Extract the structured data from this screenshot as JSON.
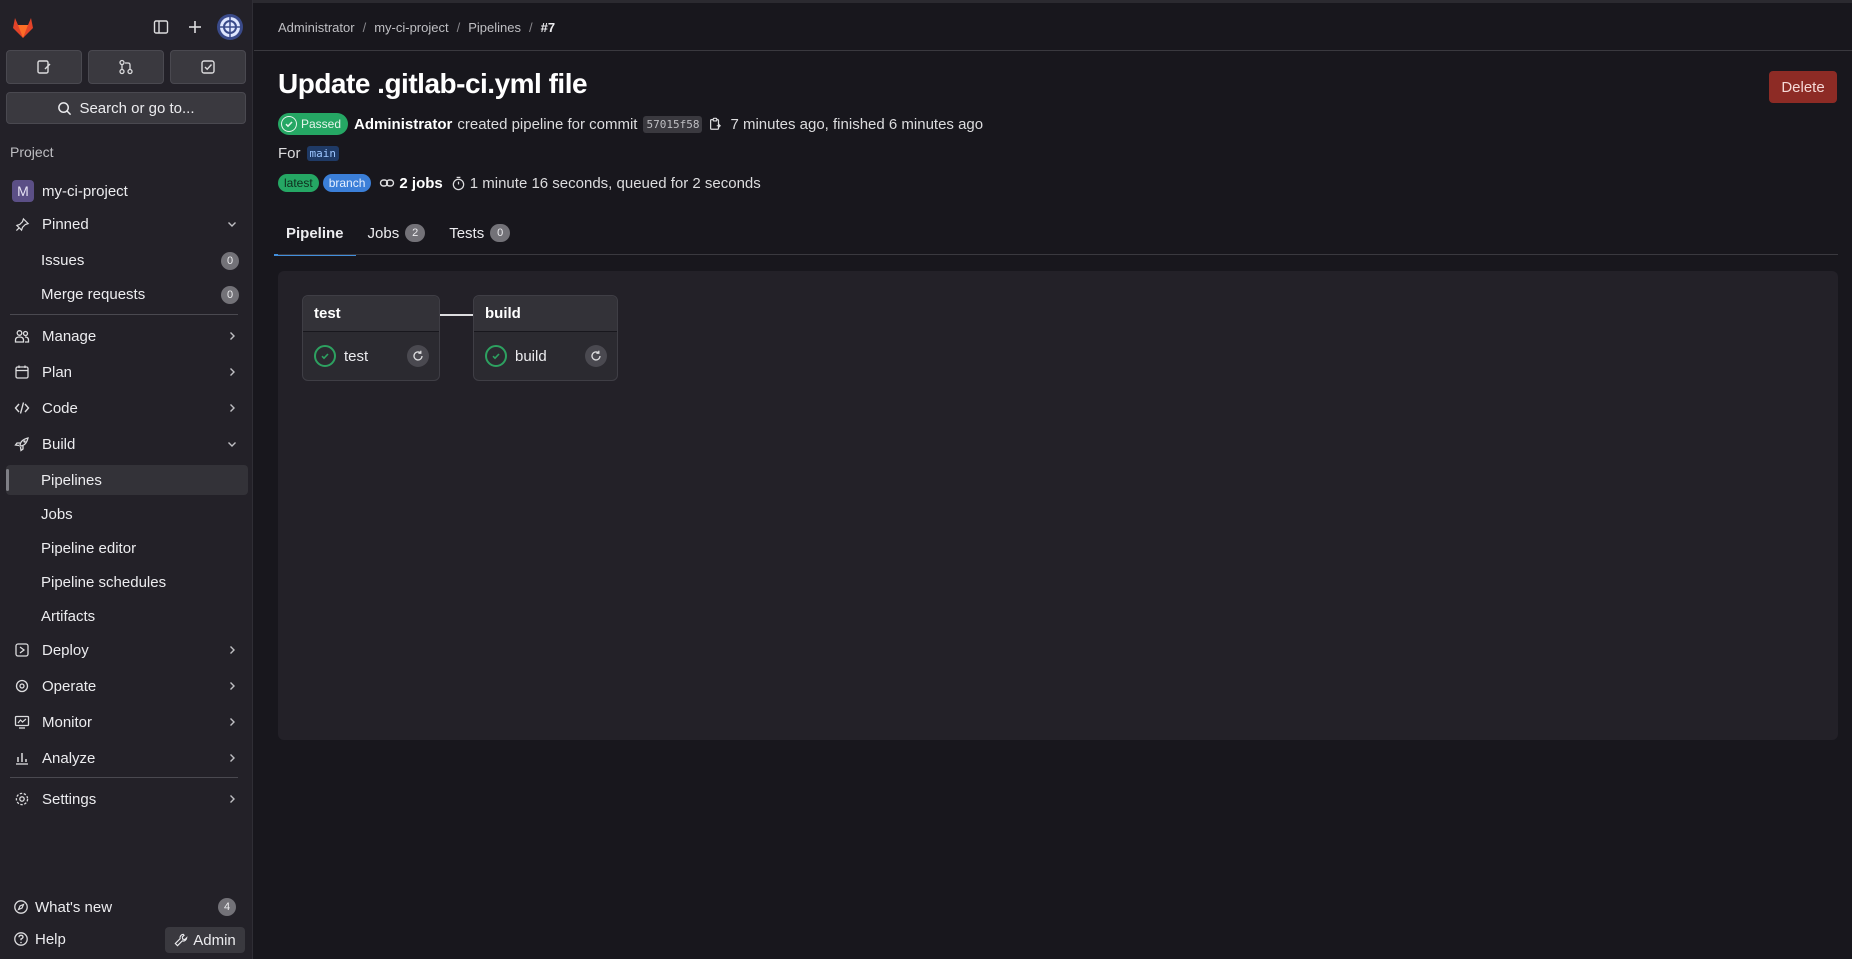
{
  "colors": {
    "accent": "#428fdc",
    "success": "#2da160",
    "danger": "#8d2b25",
    "sidebar_bg": "#232128",
    "page_bg": "#18171d"
  },
  "sidebar": {
    "search_label": "Search or go to...",
    "section_title": "Project",
    "project_name": "my-ci-project",
    "project_initial": "M",
    "pinned": {
      "label": "Pinned",
      "items": [
        {
          "label": "Issues",
          "count": "0"
        },
        {
          "label": "Merge requests",
          "count": "0"
        }
      ]
    },
    "nav": [
      {
        "label": "Manage",
        "icon": "users-icon"
      },
      {
        "label": "Plan",
        "icon": "calendar-icon"
      },
      {
        "label": "Code",
        "icon": "code-icon"
      },
      {
        "label": "Build",
        "icon": "rocket-icon"
      }
    ],
    "build_items": [
      "Pipelines",
      "Jobs",
      "Pipeline editor",
      "Pipeline schedules",
      "Artifacts"
    ],
    "nav2": [
      {
        "label": "Deploy",
        "icon": "deploy-icon"
      },
      {
        "label": "Operate",
        "icon": "cloud-gear-icon"
      },
      {
        "label": "Monitor",
        "icon": "monitor-icon"
      },
      {
        "label": "Analyze",
        "icon": "chart-icon"
      }
    ],
    "settings": "Settings",
    "whats_new": {
      "label": "What's new",
      "count": "4"
    },
    "help": "Help",
    "admin": "Admin"
  },
  "breadcrumb": [
    "Administrator",
    "my-ci-project",
    "Pipelines",
    "#7"
  ],
  "page": {
    "title": "Update .gitlab-ci.yml file",
    "delete_label": "Delete",
    "status": "Passed",
    "author": "Administrator",
    "created_text": "created pipeline for commit",
    "commit": "57015f58",
    "time_text": "7 minutes ago, finished 6 minutes ago",
    "for_label": "For",
    "branch": "main",
    "badges": [
      "latest",
      "branch"
    ],
    "jobs_text": "2 jobs",
    "duration_text": "1 minute 16 seconds, queued for 2 seconds"
  },
  "tabs": [
    {
      "label": "Pipeline",
      "count": ""
    },
    {
      "label": "Jobs",
      "count": "2"
    },
    {
      "label": "Tests",
      "count": "0"
    }
  ],
  "stages": [
    {
      "name": "test",
      "jobs": [
        {
          "name": "test",
          "status": "passed"
        }
      ]
    },
    {
      "name": "build",
      "jobs": [
        {
          "name": "build",
          "status": "passed"
        }
      ]
    }
  ]
}
